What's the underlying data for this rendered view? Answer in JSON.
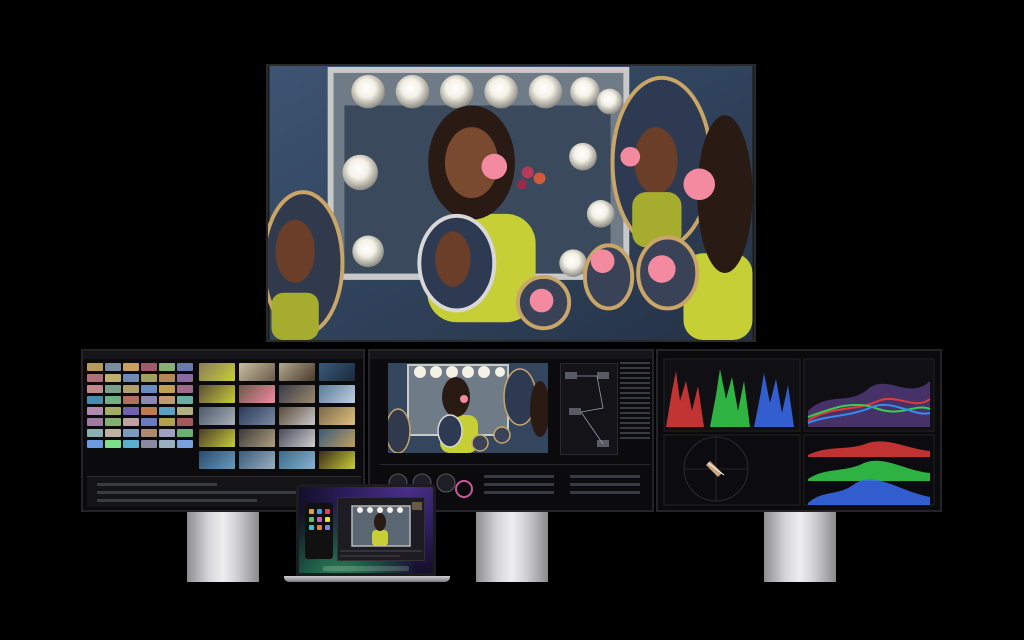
{
  "scene": {
    "description_visible_text": "",
    "devices": [
      "reference-display",
      "left-monitor",
      "center-monitor",
      "right-monitor",
      "macbook"
    ]
  },
  "colors": {
    "background": "#000000",
    "frame": "#242428",
    "stand": "#d6d6d8",
    "scope_red": "#e23a3a",
    "scope_green": "#35d04b",
    "scope_blue": "#3a6cf0",
    "wallpaper_green": "#3a8f5b",
    "wallpaper_purple": "#4b2f8a"
  },
  "icons": [
    "vectorscope-icon",
    "waveform-icon",
    "histogram-icon"
  ]
}
